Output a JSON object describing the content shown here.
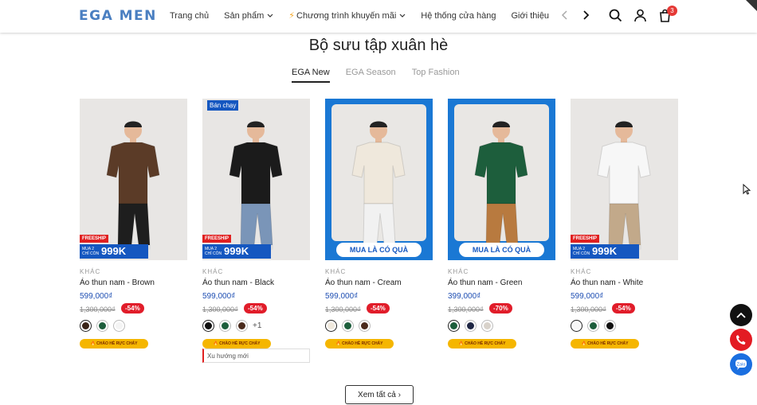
{
  "header": {
    "logo": "EGA MEN",
    "nav": [
      {
        "label": "Trang chủ",
        "dropdown": false
      },
      {
        "label": "Sản phẩm",
        "dropdown": true
      },
      {
        "label": "Chương trình khuyến mãi",
        "dropdown": true
      },
      {
        "label": "Hệ thống cửa hàng",
        "dropdown": false
      },
      {
        "label": "Giới thiệu",
        "dropdown": false
      }
    ],
    "cart_count": "3"
  },
  "section": {
    "title": "Bộ sưu tập xuân hè",
    "tabs": [
      "EGA New",
      "EGA Season",
      "Top Fashion"
    ],
    "active_tab": "EGA New"
  },
  "products": [
    {
      "brand": "KHÁC",
      "name": "Áo thun nam - Brown",
      "price": "599,000₫",
      "old_price": "1,300,000₫",
      "discount": "-54%",
      "promo": "freeship",
      "freeship_label": "FREESHIP",
      "promo_small": "MUA 2 CHỈ CÒN",
      "promo_big": "999K",
      "shirt": "#5b3b27",
      "pants": "#1e1e1e",
      "swatches": [
        "#3a2418",
        "#1d5e3c",
        "#f4f4f4"
      ],
      "selected": 0,
      "hot_pill": "CHÀO HÈ RỰC CHÁY"
    },
    {
      "brand": "KHÁC",
      "name": "Áo thun nam - Black",
      "price": "599,000₫",
      "old_price": "1,300,000₫",
      "discount": "-54%",
      "promo": "freeship",
      "freeship_label": "FREESHIP",
      "promo_small": "MUA 2 CHỈ CÒN",
      "promo_big": "999K",
      "hot_badge": "Bán chạy",
      "shirt": "#1b1b1b",
      "pants": "#7a95b8",
      "swatches": [
        "#111111",
        "#1d5e3c",
        "#4a2a1c"
      ],
      "selected": 0,
      "more": "+1",
      "hot_pill": "CHÀO HÈ RỰC CHÁY",
      "trend": "Xu hướng mới"
    },
    {
      "brand": "KHÁC",
      "name": "Áo thun nam - Cream",
      "price": "599,000₫",
      "old_price": "1,300,000₫",
      "discount": "-54%",
      "promo": "gift",
      "gift_label": "MUA LÀ CÓ QUÀ",
      "shirt": "#efe8dc",
      "pants": "#f1f1f1",
      "swatches": [
        "#efe8dc",
        "#1d5e3c",
        "#4a2a1c"
      ],
      "selected": 0,
      "hot_pill": "CHÀO HÈ RỰC CHÁY"
    },
    {
      "brand": "KHÁC",
      "name": "Áo thun nam - Green",
      "price": "399,000₫",
      "old_price": "1,300,000₫",
      "discount": "-70%",
      "promo": "gift",
      "gift_label": "MUA LÀ CÓ QUÀ",
      "shirt": "#1d5e3c",
      "pants": "#b87a3f",
      "swatches": [
        "#1d5e3c",
        "#1f2744",
        "#d8d2ca"
      ],
      "selected": 0,
      "hot_pill": "CHÀO HÈ RỰC CHÁY"
    },
    {
      "brand": "KHÁC",
      "name": "Áo thun nam - White",
      "price": "599,000₫",
      "old_price": "1,300,000₫",
      "discount": "-54%",
      "promo": "freeship",
      "freeship_label": "FREESHIP",
      "promo_small": "MUA 2 CHỈ CÒN",
      "promo_big": "999K",
      "shirt": "#f7f7f7",
      "pants": "#c2a98a",
      "swatches": [
        "#f7f7f7",
        "#1d5e3c",
        "#111111"
      ],
      "selected": 0,
      "hot_pill": "CHÀO HÈ RỰC CHÁY"
    }
  ],
  "see_all": "Xem tất cả"
}
